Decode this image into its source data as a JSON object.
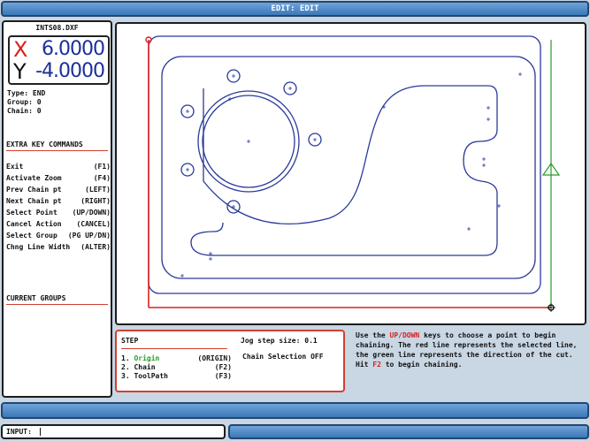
{
  "title": "EDIT: EDIT",
  "file": {
    "name": "INTS08.DXF"
  },
  "dro": {
    "x_label": "X",
    "x_value": "6.0000",
    "y_label": "Y",
    "y_value": "-4.0000"
  },
  "info": [
    {
      "label": "Type:",
      "value": "END"
    },
    {
      "label": "Group:",
      "value": "0"
    },
    {
      "label": "Chain:",
      "value": "0"
    }
  ],
  "extra_keys": {
    "heading": "EXTRA KEY COMMANDS",
    "items": [
      {
        "label": "Exit",
        "key": "(F1)"
      },
      {
        "label": "Activate Zoom",
        "key": "(F4)"
      },
      {
        "label": "Prev Chain pt",
        "key": "(LEFT)"
      },
      {
        "label": "Next Chain pt",
        "key": "(RIGHT)"
      },
      {
        "label": "Select Point",
        "key": "(UP/DOWN)"
      },
      {
        "label": "Cancel Action",
        "key": "(CANCEL)"
      },
      {
        "label": "Select Group",
        "key": "(PG UP/DN)"
      },
      {
        "label": "Chng Line Width",
        "key": "(ALTER)"
      }
    ]
  },
  "current_groups": {
    "heading": "CURRENT GROUPS"
  },
  "step": {
    "heading": "STEP",
    "items": [
      {
        "num": "1.",
        "label": "Origin",
        "key": "(ORIGIN)"
      },
      {
        "num": "2.",
        "label": "Chain",
        "key": "(F2)"
      },
      {
        "num": "3.",
        "label": "ToolPath",
        "key": "(F3)"
      }
    ]
  },
  "jog": {
    "label": "Jog step size:",
    "value": "0.1"
  },
  "chain_selection": "Chain Selection OFF",
  "help": {
    "p1": "Use the ",
    "k1": "UP/DOWN",
    "p2": " keys to choose a point to begin chaining. The red line represents the selected line, the green line represents the direction of the cut. Hit ",
    "k2": "F2",
    "p3": " to begin chaining."
  },
  "input": {
    "label": "INPUT:",
    "value": ""
  },
  "colors": {
    "part": "#2a3a9a",
    "selected": "#d82020",
    "direction": "#2a9a2a",
    "bar": "#4a86c6"
  }
}
